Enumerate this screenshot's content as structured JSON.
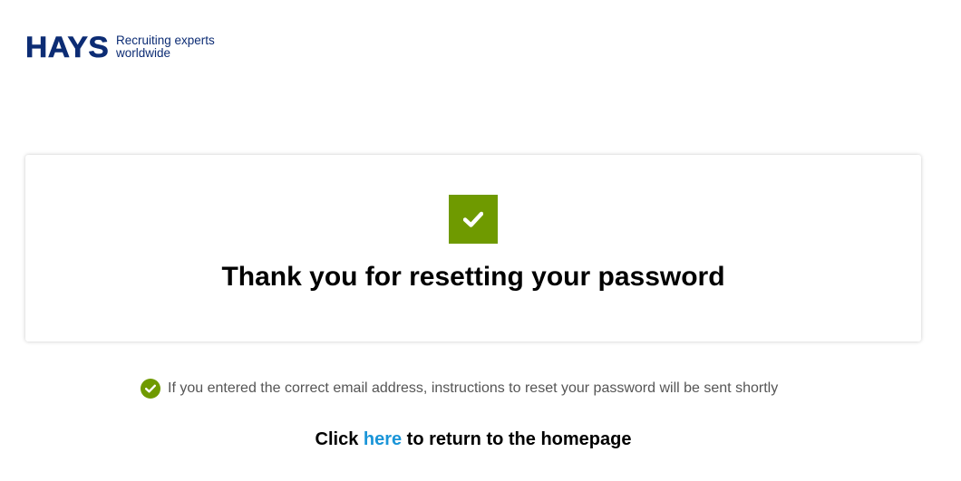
{
  "header": {
    "logo_text": "HAYS",
    "tagline_line1": "Recruiting experts",
    "tagline_line2": "worldwide"
  },
  "card": {
    "icon": "checkmark-icon",
    "title": "Thank you for resetting your password"
  },
  "info": {
    "icon": "check-circle-icon",
    "text": "If you entered the correct email address, instructions to reset your password will be sent shortly"
  },
  "return_link": {
    "prefix": "Click ",
    "link_text": "here",
    "suffix": " to return to the homepage"
  },
  "colors": {
    "brand_navy": "#0c2c74",
    "success_green": "#6f9a00",
    "link_blue": "#1a95d8"
  }
}
